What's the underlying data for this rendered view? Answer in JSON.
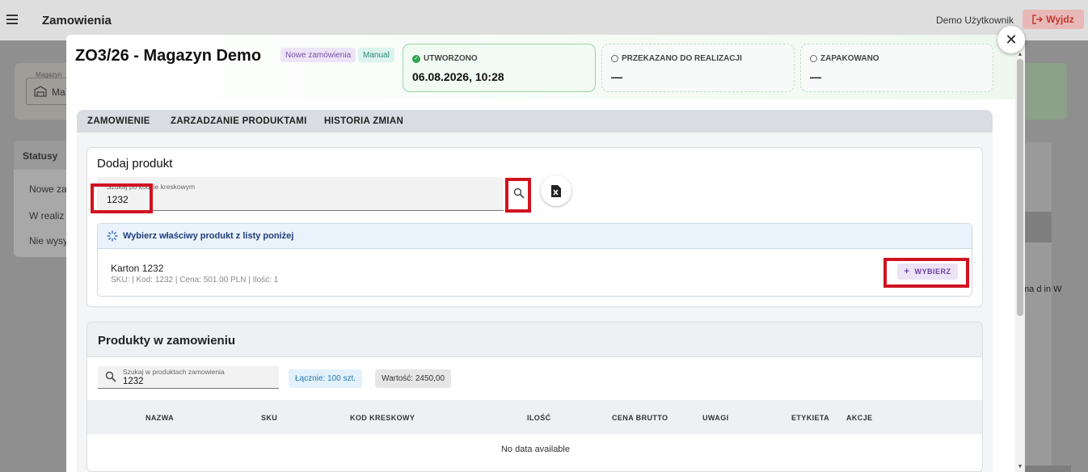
{
  "app": {
    "title": "Zamowienia",
    "user": "Demo Użytkownik",
    "logout_label": "Wyjdz"
  },
  "background": {
    "warehouse_label": "Magazyn",
    "warehouse_value": "Ma",
    "status_title": "Statusy",
    "status_items": [
      "Nowe za",
      "W realiz",
      "Nie wysy"
    ],
    "right_text": "ma      d in W"
  },
  "dialog": {
    "title": "ZO3/26 - Magazyn Demo",
    "chips": [
      "Nowe zamówienia",
      "Manual"
    ],
    "stages": [
      {
        "label": "UTWORZONO",
        "value": "06.08.2026, 10:28",
        "done": true
      },
      {
        "label": "PRZEKAZANO DO REALIZACJI",
        "value": "—",
        "done": false
      },
      {
        "label": "ZAPAKOWANO",
        "value": "—",
        "done": false
      }
    ],
    "tabs": [
      "ZAMOWIENIE",
      "ZARZADZANIE PRODUKTAMI",
      "HISTORIA ZMIAN"
    ]
  },
  "add_product": {
    "title": "Dodaj produkt",
    "search_label": "Szukaj po kodzie kreskowym",
    "search_value": "1232",
    "hint": "Wybierz właściwy produkt z listy poniżej",
    "result_name": "Karton 1232",
    "result_meta": "SKU: | Kod: 1232 | Cena: 501.00 PLN | Ilość: 1",
    "choose_label": "WYBIERZ"
  },
  "products": {
    "title": "Produkty w zamowieniu",
    "search_label": "Szukaj w produktach zamowienia",
    "search_value": "1232",
    "total_badge": "Łącznie: 100 szt.",
    "value_badge": "Wartość: 2450,00",
    "columns": [
      "NAZWA",
      "SKU",
      "KOD KRESKOWY",
      "ILOŚĆ",
      "CENA BRUTTO",
      "UWAGI",
      "ETYKIETA",
      "AKCJE"
    ],
    "empty_text": "No data available"
  },
  "colors": {
    "highlight": "#d0131f",
    "success": "#2ea44f",
    "logout": "#c0392b",
    "choose": "#6b3fa0"
  }
}
